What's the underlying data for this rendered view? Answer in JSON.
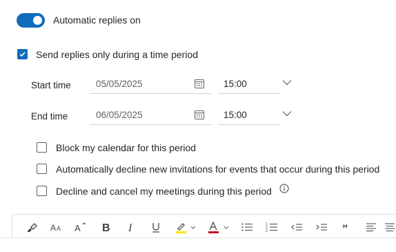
{
  "auto_reply": {
    "label": "Automatic replies on",
    "on": true
  },
  "time_period": {
    "label": "Send replies only during a time period",
    "checked": true
  },
  "start": {
    "label": "Start time",
    "date": "05/05/2025",
    "time": "15:00"
  },
  "end": {
    "label": "End time",
    "date": "06/05/2025",
    "time": "15:00"
  },
  "options": [
    {
      "label": "Block my calendar for this period",
      "checked": false
    },
    {
      "label": "Automatically decline new invitations for events that occur during this period",
      "checked": false
    },
    {
      "label": "Decline and cancel my meetings during this period",
      "checked": false
    }
  ],
  "toolbar": {
    "icons": [
      "format-painter-icon",
      "font-size-icon",
      "grow-font-icon",
      "bold-icon",
      "italic-icon",
      "underline-icon",
      "highlight-icon",
      "font-color-icon",
      "bullets-icon",
      "numbering-icon",
      "decrease-indent-icon",
      "increase-indent-icon",
      "quote-icon",
      "align-left-icon"
    ],
    "accent": "#0f6cbd",
    "highlight_color": "#ffe600",
    "font_color": "#c50f1f"
  }
}
